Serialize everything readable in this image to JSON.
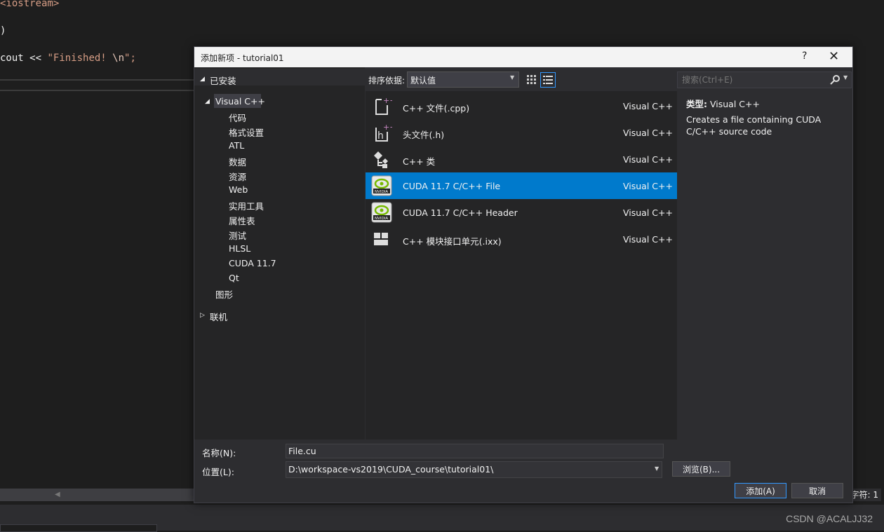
{
  "editor": {
    "code_line1_text": "iostream>",
    "code_line1_prefix": "<",
    "code_line2": ")",
    "code_line3_prefix": "cout << ",
    "code_line3_string": "\"Finished! ",
    "code_line3_escape": "\\n",
    "code_line3_suffix": "\";",
    "status_char": "字符: 1"
  },
  "watermark": "CSDN @ACALJJ32",
  "dialog": {
    "title": "添加新项 - tutorial01",
    "help": "?",
    "close": "✕",
    "tree": {
      "installed": "已安装",
      "visual_cpp": "Visual C++",
      "children": [
        "代码",
        "格式设置",
        "ATL",
        "数据",
        "资源",
        "Web",
        "实用工具",
        "属性表",
        "测试",
        "HLSL",
        "CUDA 11.7",
        "Qt"
      ],
      "graphics": "图形",
      "online": "联机"
    },
    "toolbar": {
      "sort_label": "排序依据:",
      "sort_value": "默认值"
    },
    "search": {
      "placeholder": "搜索(Ctrl+E)"
    },
    "templates": [
      {
        "name": "C++ 文件(.cpp)",
        "type": "Visual C++",
        "icon": "cpp-file-icon"
      },
      {
        "name": "头文件(.h)",
        "type": "Visual C++",
        "icon": "header-file-icon"
      },
      {
        "name": "C++ 类",
        "type": "Visual C++",
        "icon": "cpp-class-icon"
      },
      {
        "name": "CUDA 11.7 C/C++ File",
        "type": "Visual C++",
        "icon": "nvidia-icon",
        "selected": true
      },
      {
        "name": "CUDA 11.7 C/C++ Header",
        "type": "Visual C++",
        "icon": "nvidia-icon"
      },
      {
        "name": "C++ 模块接口单元(.ixx)",
        "type": "Visual C++",
        "icon": "module-icon"
      }
    ],
    "details": {
      "type_label": "类型:",
      "type_value": "Visual C++",
      "description": "Creates a file containing CUDA C/C++ source code"
    },
    "bottom": {
      "name_label": "名称(N):",
      "name_value": "File.cu",
      "location_label": "位置(L):",
      "location_value": "D:\\workspace-vs2019\\CUDA_course\\tutorial01\\",
      "browse": "浏览(B)...",
      "add": "添加(A)",
      "cancel": "取消"
    }
  },
  "colors": {
    "selection": "#007acc",
    "accent": "#3399ff",
    "dialog_bg": "#2d2d30"
  }
}
